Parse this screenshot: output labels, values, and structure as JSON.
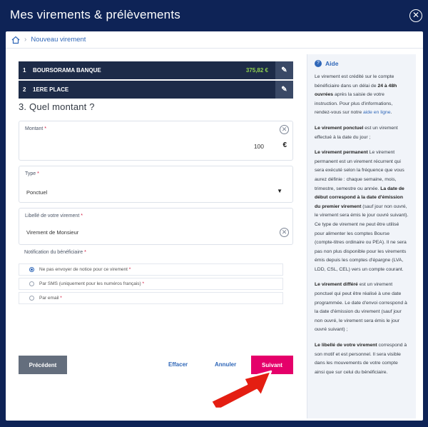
{
  "modal": {
    "title": "Mes virements & prélèvements"
  },
  "breadcrumb": {
    "current": "Nouveau virement"
  },
  "steps": [
    {
      "num": "1",
      "name": "BOURSORAMA BANQUE",
      "amount": "375,82 €"
    },
    {
      "num": "2",
      "name": "1ERE PLACE"
    }
  ],
  "step3_title": "3. Quel montant ?",
  "amount_field": {
    "label": "Montant",
    "value": "100",
    "currency": "€"
  },
  "type_field": {
    "label": "Type",
    "value": "Ponctuel"
  },
  "label_field": {
    "label": "Libellé de votre virement",
    "value": "Virement de Monsieur"
  },
  "notification": {
    "title": "Notification du bénéficiaire",
    "options": [
      {
        "text": "Ne pas envoyer de notice pour ce virement",
        "selected": true
      },
      {
        "text": "Par SMS (uniquement pour les numéros français)",
        "selected": false
      },
      {
        "text": "Par email",
        "selected": false
      }
    ]
  },
  "buttons": {
    "previous": "Précédent",
    "clear": "Effacer",
    "cancel": "Annuler",
    "next": "Suivant"
  },
  "help": {
    "title": "Aide",
    "p1_a": "Le virement est crédité sur le compte bénéficiaire dans un délai de ",
    "p1_b": "24 à 48h ouvrées",
    "p1_c": " après la saisie de votre instruction. Pour plus d'informations, rendez-vous sur notre ",
    "p1_link": "aide en ligne",
    "p1_d": ".",
    "p2_b": "Le virement ponctuel",
    "p2_c": " est un virement effectué à la date du jour ;",
    "p3_b": "Le virement permanent",
    "p3_c": " Le virement permanent est un virement récurrent qui sera exécuté selon la fréquence que vous aurez définie : chaque semaine, mois, trimestre, semestre ou année. ",
    "p3_b2": "La date de début correspond à la date d'émission du premier virement",
    "p3_d": " (sauf jour non ouvré, le virement sera émis le jour ouvré suivant). Ce type de virement ne peut être utilisé pour alimenter les comptes Bourse (compte-titres ordinaire ou PEA). Il ne sera pas non plus disponible pour les virements émis depuis les comptes d'épargne (LVA, LDD, CSL, CEL) vers un compte courant.",
    "p4_b": "Le virement différé",
    "p4_c": " est un virement ponctuel qui peut être réalisé à une date programmée. Le date d'envoi correspond à la date d'émission du virement (sauf jour non ouvré, le virement sera émis le jour ouvré suivant) ;",
    "p5_b": "Le libellé de votre virement",
    "p5_c": " correspond à son motif et est personnel. Il sera visible dans les mouvements de votre compte ainsi que sur celui du bénéficiaire."
  },
  "colors": {
    "navy": "#0e2356",
    "primary_link": "#2f67b8",
    "next_button": "#e5006a",
    "arrow": "#e41e12"
  }
}
